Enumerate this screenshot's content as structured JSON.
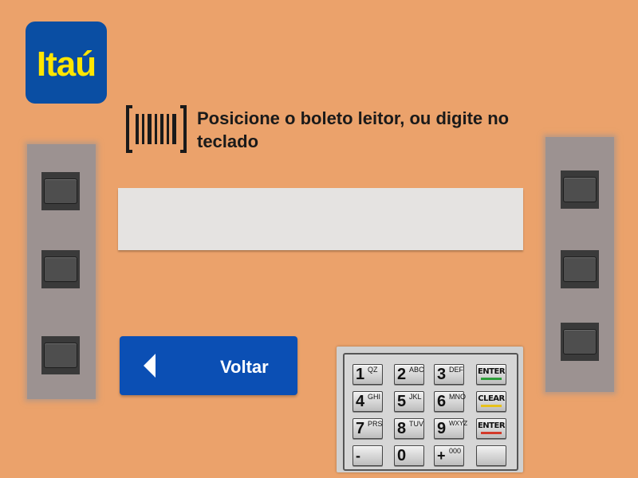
{
  "brand": {
    "logo_text": "Itaú",
    "bg_color": "#0a4ea3",
    "text_color": "#ffe600"
  },
  "instruction": {
    "icon": "barcode-scan-icon",
    "text": "Posicione o boleto leitor, ou digite no teclado"
  },
  "input": {
    "value": "",
    "placeholder": ""
  },
  "back_button": {
    "label": "Voltar",
    "icon": "chevron-left-icon",
    "color": "#0b4fb4"
  },
  "side_buttons": {
    "left_count": 3,
    "right_count": 3
  },
  "keypad": {
    "keys": [
      {
        "digit": "1",
        "letters": "QZ"
      },
      {
        "digit": "2",
        "letters": "ABC"
      },
      {
        "digit": "3",
        "letters": "DEF"
      },
      {
        "digit": "4",
        "letters": "GHI"
      },
      {
        "digit": "5",
        "letters": "JKL"
      },
      {
        "digit": "6",
        "letters": "MNO"
      },
      {
        "digit": "7",
        "letters": "PRS"
      },
      {
        "digit": "8",
        "letters": "TUV"
      },
      {
        "digit": "9",
        "letters": "WXYZ"
      },
      {
        "digit": "-",
        "letters": ""
      },
      {
        "digit": "0",
        "letters": ""
      },
      {
        "digit": "+",
        "letters": "000"
      }
    ],
    "function_keys": [
      {
        "label": "ENTER",
        "color": "#2e9e3a"
      },
      {
        "label": "CLEAR",
        "color": "#e8c21a"
      },
      {
        "label": "ENTER",
        "color": "#d33a2a"
      },
      {
        "label": "",
        "color": ""
      }
    ]
  },
  "colors": {
    "background": "#eba26b",
    "side_panel": "#9c9291",
    "input_bg": "#e5e3e1"
  }
}
